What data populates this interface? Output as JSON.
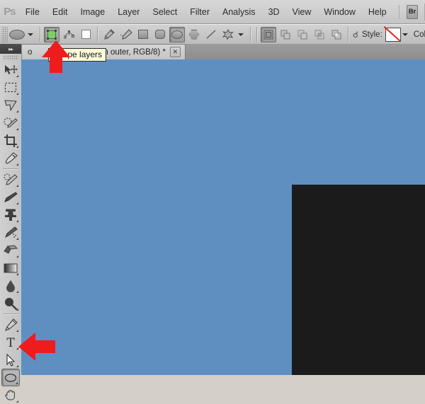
{
  "app": {
    "name": "Adobe Photoshop",
    "logo_text": "Ps"
  },
  "menubar": {
    "items": [
      {
        "label": "File"
      },
      {
        "label": "Edit"
      },
      {
        "label": "Image"
      },
      {
        "label": "Layer"
      },
      {
        "label": "Select"
      },
      {
        "label": "Filter"
      },
      {
        "label": "Analysis"
      },
      {
        "label": "3D"
      },
      {
        "label": "View"
      },
      {
        "label": "Window"
      },
      {
        "label": "Help"
      }
    ],
    "bridge_button": "Br"
  },
  "options_bar": {
    "tool_preset_icon": "ellipse-preview-icon",
    "mode_buttons": [
      {
        "name": "shape-layers-button",
        "label": "Shape layers",
        "selected": true
      },
      {
        "name": "paths-button",
        "label": "Paths",
        "selected": false
      },
      {
        "name": "fill-pixels-button",
        "label": "Fill pixels",
        "selected": false
      }
    ],
    "shape_tools": [
      {
        "name": "pen-tool-button",
        "label": "Pen Tool",
        "selected": false
      },
      {
        "name": "freeform-pen-tool-button",
        "label": "Freeform Pen Tool",
        "selected": false
      },
      {
        "name": "rectangle-tool-button",
        "label": "Rectangle Tool",
        "selected": false
      },
      {
        "name": "rounded-rectangle-tool-button",
        "label": "Rounded Rectangle Tool",
        "selected": false
      },
      {
        "name": "ellipse-tool-button",
        "label": "Ellipse Tool",
        "selected": true
      },
      {
        "name": "polygon-tool-button",
        "label": "Polygon Tool",
        "selected": false
      },
      {
        "name": "line-tool-button",
        "label": "Line Tool",
        "selected": false
      },
      {
        "name": "custom-shape-tool-button",
        "label": "Custom Shape Tool",
        "selected": false
      }
    ],
    "combine_buttons": [
      {
        "name": "create-new-shape-layer-button",
        "label": "Create new shape layer",
        "selected": true
      },
      {
        "name": "add-to-shape-area-button",
        "label": "Add to shape area",
        "selected": false
      },
      {
        "name": "subtract-from-shape-area-button",
        "label": "Subtract from shape area",
        "selected": false
      },
      {
        "name": "intersect-shape-areas-button",
        "label": "Intersect shape areas",
        "selected": false
      },
      {
        "name": "exclude-overlapping-shape-areas-button",
        "label": "Exclude overlapping shape areas",
        "selected": false
      }
    ],
    "style_label": "Style:",
    "style_value": "None",
    "color_label": "Color:",
    "color_value": "#000000"
  },
  "tabs": [
    {
      "label_visible_left": "o",
      "label_visible_right": "ain outer, RGB/8) *",
      "close_label": "✕",
      "active": true
    }
  ],
  "tooltip": {
    "text": "Shape layers",
    "visible": true
  },
  "toolbox": {
    "collapse_label": "▸▸",
    "tools": [
      {
        "name": "move-tool",
        "label": "Move Tool",
        "selected": false
      },
      {
        "name": "rectangular-marquee-tool",
        "label": "Rectangular Marquee Tool",
        "selected": false
      },
      {
        "name": "lasso-tool",
        "label": "Lasso Tool",
        "selected": false
      },
      {
        "name": "quick-selection-tool",
        "label": "Quick Selection Tool",
        "selected": false
      },
      {
        "name": "crop-tool",
        "label": "Crop Tool",
        "selected": false
      },
      {
        "name": "eyedropper-tool",
        "label": "Eyedropper Tool",
        "selected": false
      },
      {
        "name": "spot-healing-brush-tool",
        "label": "Spot Healing Brush Tool",
        "selected": false
      },
      {
        "name": "brush-tool",
        "label": "Brush Tool",
        "selected": false
      },
      {
        "name": "clone-stamp-tool",
        "label": "Clone Stamp Tool",
        "selected": false
      },
      {
        "name": "history-brush-tool",
        "label": "History Brush Tool",
        "selected": false
      },
      {
        "name": "eraser-tool",
        "label": "Eraser Tool",
        "selected": false
      },
      {
        "name": "gradient-tool",
        "label": "Gradient Tool",
        "selected": false
      },
      {
        "name": "blur-tool",
        "label": "Blur Tool",
        "selected": false
      },
      {
        "name": "dodge-tool",
        "label": "Dodge Tool",
        "selected": false
      },
      {
        "name": "pen-tool",
        "label": "Pen Tool",
        "selected": false
      },
      {
        "name": "horizontal-type-tool",
        "label": "Horizontal Type Tool",
        "selected": false
      },
      {
        "name": "path-selection-tool",
        "label": "Path Selection Tool",
        "selected": false
      },
      {
        "name": "ellipse-shape-tool",
        "label": "Ellipse Tool",
        "selected": true
      },
      {
        "name": "hand-tool",
        "label": "Hand Tool",
        "selected": false
      }
    ]
  },
  "canvas": {
    "background_color": "#5e8fc0",
    "shape_color": "#1b1b1b"
  },
  "annotations": [
    {
      "name": "arrow-up-shape-layers",
      "direction": "up",
      "color": "#ee1c1c"
    },
    {
      "name": "arrow-left-ellipse-tool",
      "direction": "left",
      "color": "#ee1c1c"
    }
  ]
}
